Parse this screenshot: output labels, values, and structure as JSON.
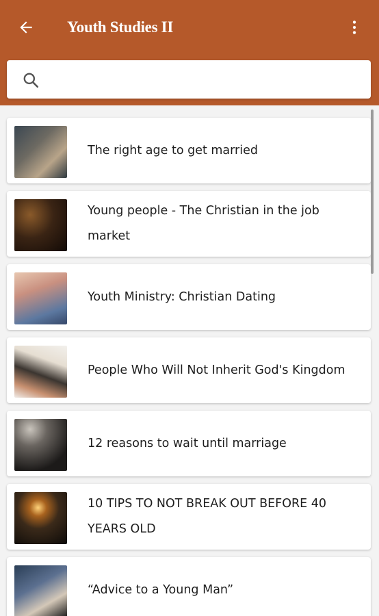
{
  "header": {
    "title": "Youth Studies II",
    "back_icon": "arrow-left-icon",
    "menu_icon": "more-vert-icon",
    "color": "#b5592a"
  },
  "search": {
    "placeholder": "",
    "value": "",
    "icon": "search-icon"
  },
  "articles": [
    {
      "title": "The right age to get married"
    },
    {
      "title": "Young people - The Christian in the job market"
    },
    {
      "title": "Youth Ministry: Christian Dating"
    },
    {
      "title": "People Who Will Not Inherit God's Kingdom"
    },
    {
      "title": "12 reasons to wait until marriage"
    },
    {
      "title": "10 TIPS TO NOT BREAK OUT BEFORE 40 YEARS OLD"
    },
    {
      "title": "“Advice to a Young Man”"
    }
  ]
}
